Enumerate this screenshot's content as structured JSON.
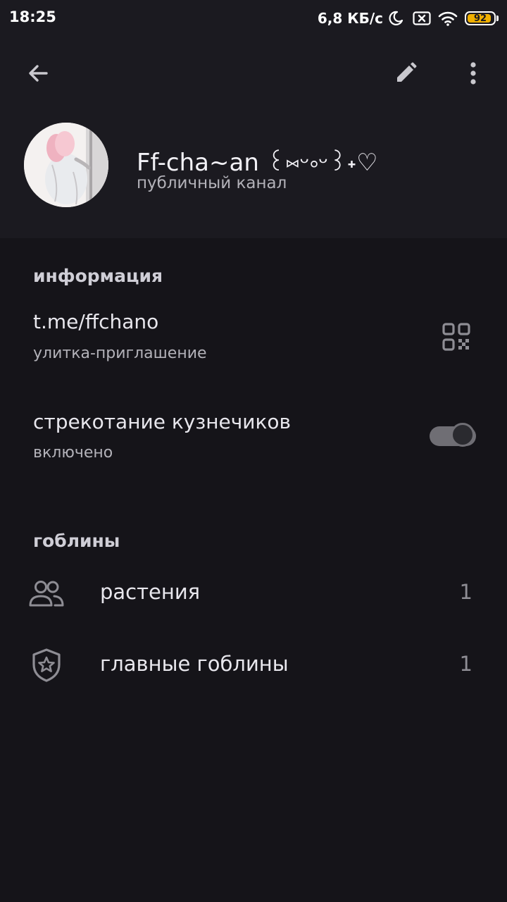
{
  "status_bar": {
    "time": "18:25",
    "network_speed": "6,8 КБ/с",
    "battery_level": "92",
    "battery_percent": 92,
    "icons": [
      "moon-icon",
      "sim-off-icon",
      "wifi-icon",
      "battery-icon"
    ],
    "battery_color": "#f0b000"
  },
  "toolbar": {
    "icons": [
      "back-arrow-icon",
      "pencil-icon",
      "more-vertical-icon"
    ]
  },
  "profile": {
    "title": "Ff-cha~an ꒰⑅ᵕ༚ᵕ꒱˖♡",
    "subtitle": "публичный канал"
  },
  "info_section": {
    "title": "информация",
    "link": {
      "value": "t.me/ffchano",
      "label": "улитка-приглашение",
      "icon": "qr-code-icon"
    },
    "cricket": {
      "value": "стрекотание кузнечиков",
      "label": "включено",
      "toggle_on": true
    }
  },
  "goblins_section": {
    "title": "гоблины",
    "items": [
      {
        "icon": "people-icon",
        "label": "растения",
        "count": "1"
      },
      {
        "icon": "shield-star-icon",
        "label": "главные гоблины",
        "count": "1"
      }
    ]
  },
  "colors": {
    "background": "#151419",
    "header_background": "#1b1a20",
    "primary_text": "#e8e7ed",
    "secondary_text": "#b3b2b9",
    "icon": "#8e8d94"
  }
}
